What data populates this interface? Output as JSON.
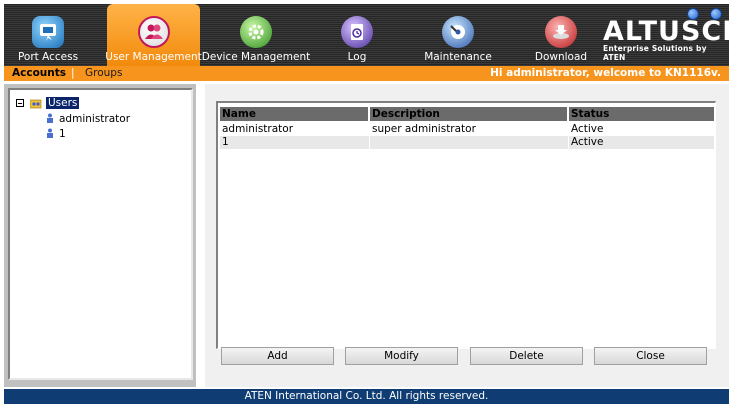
{
  "nav": {
    "tabs": [
      {
        "label": "Port Access",
        "icon": "port-access-icon",
        "active": false
      },
      {
        "label": "User Management",
        "icon": "users-icon",
        "active": true
      },
      {
        "label": "Device Management",
        "icon": "device-gear-icon",
        "active": false
      },
      {
        "label": "Log",
        "icon": "log-clock-icon",
        "active": false
      },
      {
        "label": "Maintenance",
        "icon": "maintenance-disc-icon",
        "active": false
      },
      {
        "label": "Download",
        "icon": "download-disc-icon",
        "active": false
      }
    ],
    "logo": {
      "brand": "ALTUSCN",
      "tm": "™",
      "tagline": "Enterprise Solutions by ATEN"
    }
  },
  "subnav": {
    "accounts": "Accounts",
    "separator": "|",
    "groups": "Groups",
    "welcome": "Hi administrator, welcome to KN1116v."
  },
  "tree": {
    "root": "Users",
    "items": [
      "administrator",
      "1"
    ]
  },
  "table": {
    "columns": [
      "Name",
      "Description",
      "Status"
    ],
    "rows": [
      {
        "name": "administrator",
        "description": "super administrator",
        "status": "Active"
      },
      {
        "name": "1",
        "description": "",
        "status": "Active"
      }
    ]
  },
  "buttons": {
    "add": "Add",
    "modify": "Modify",
    "delete": "Delete",
    "close": "Close"
  },
  "footer": {
    "text": "ATEN International Co. Ltd. All rights reserved."
  },
  "colors": {
    "accent": "#f7941d",
    "footer": "#0f3d73",
    "selection": "#0a246a"
  }
}
